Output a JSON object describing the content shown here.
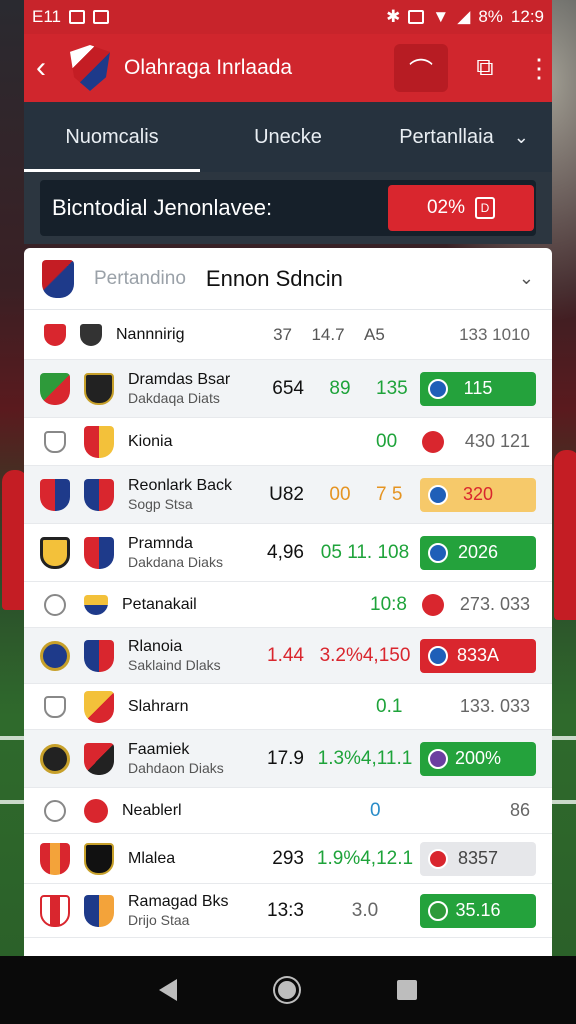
{
  "status_bar": {
    "left": "E11",
    "battery": "8%",
    "time": "12:9"
  },
  "app_bar": {
    "title": "Olahraga Inrlaada"
  },
  "tabs": [
    {
      "label": "Nuomcalis",
      "active": true
    },
    {
      "label": "Unecke",
      "active": false
    },
    {
      "label": "Pertanllaia",
      "active": false
    }
  ],
  "banner": {
    "text": "Bicntodial Jenonlavee:",
    "button_label": "02%"
  },
  "panel": {
    "sub_title": "Pertandino",
    "title": "Ennon Sdncin"
  },
  "header_row": {
    "name": "Nannnirig",
    "col1": "37",
    "col2": "14.7",
    "col3": "A5",
    "col4": "133 1010"
  },
  "rows": [
    {
      "name": "Dramdas Bsar",
      "sub": "Dakdaqa Diats",
      "c1": "654",
      "c2": "89",
      "c3": "135",
      "result": "115",
      "result_style": "green"
    },
    {
      "name": "Kionia",
      "sub": "",
      "c1": "",
      "c2": "",
      "c3": "00",
      "result": "430 121",
      "result_style": "plain"
    },
    {
      "name": "Reonlark Back",
      "sub": "Sogp Stsa",
      "c1": "U82",
      "c2": "00",
      "c3": "7 5",
      "result": "320",
      "result_style": "yellow"
    },
    {
      "name": "Pramnda",
      "sub": "Dakdana Diaks",
      "c1": "4,96",
      "c2": "05 11. 108",
      "c3": "",
      "result": "2026",
      "result_style": "green"
    },
    {
      "name": "Petanakail",
      "sub": "",
      "c1": "",
      "c2": "",
      "c3": "10:8",
      "result": "273. 033",
      "result_style": "plain"
    },
    {
      "name": "Rlanoia",
      "sub": "Saklaind Dlaks",
      "c1": "1.44",
      "c2": "3.2%4,150",
      "c3": "",
      "result": "833A",
      "result_style": "red"
    },
    {
      "name": "Slahrarn",
      "sub": "",
      "c1": "",
      "c2": "",
      "c3": "0.1",
      "result": "133. 033",
      "result_style": "plain"
    },
    {
      "name": "Faamiek",
      "sub": "Dahdaon Diaks",
      "c1": "17.9",
      "c2": "1.3%4,11.1",
      "c3": "",
      "result": "200%",
      "result_style": "green"
    },
    {
      "name": "Neablerl",
      "sub": "",
      "c1": "",
      "c2": "",
      "c3": "0",
      "result": "86",
      "result_style": "plain"
    },
    {
      "name": "Mlalea",
      "sub": "",
      "c1": "293",
      "c2": "1.9%4,12.1",
      "c3": "",
      "result": "8357",
      "result_style": "grey"
    },
    {
      "name": "Ramagad Bks",
      "sub": "Drijo Staa",
      "c1": "13:3",
      "c2": "3.0",
      "c3": "",
      "result": "35.16",
      "result_style": "green"
    }
  ]
}
